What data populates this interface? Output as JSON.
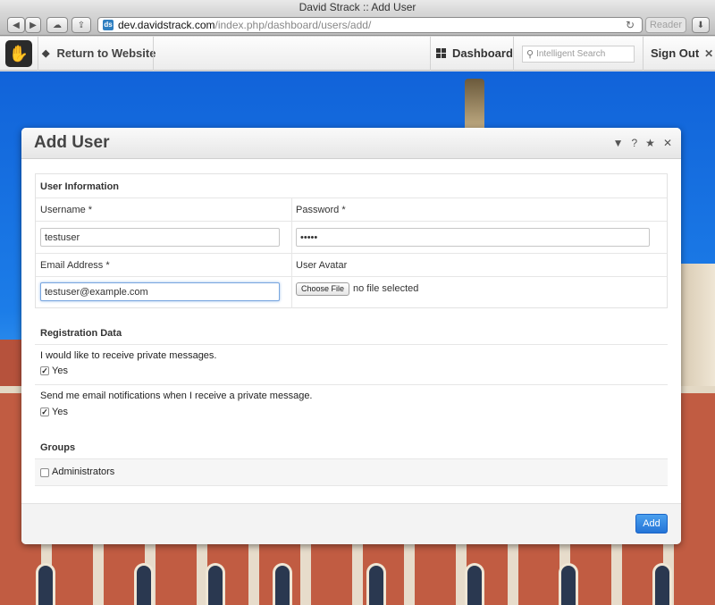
{
  "window": {
    "title": "David Strack :: Add User"
  },
  "browser": {
    "back_icon": "chevron-left-icon",
    "forward_icon": "chevron-right-icon",
    "address_host": "dev.davidstrack.com",
    "address_path": "/index.php/dashboard/users/add/",
    "reader_label": "Reader"
  },
  "cms_bar": {
    "return_label": "Return to Website",
    "dashboard_label": "Dashboard",
    "search_placeholder": "Intelligent Search",
    "signout_label": "Sign Out"
  },
  "dialog": {
    "title": "Add User",
    "controls": [
      "▼",
      "?",
      "★",
      "✕"
    ],
    "user_info": {
      "section_title": "User Information",
      "username_label": "Username *",
      "username_value": "testuser",
      "password_label": "Password *",
      "password_value": "•••••",
      "email_label": "Email Address *",
      "email_value": "testuser@example.com",
      "avatar_label": "User Avatar",
      "choose_file_label": "Choose File",
      "file_status": "no file selected"
    },
    "registration": {
      "section_title": "Registration Data",
      "q1": "I would like to receive private messages.",
      "q1_option": "Yes",
      "q1_checked": true,
      "q2": "Send me email notifications when I receive a private message.",
      "q2_option": "Yes",
      "q2_checked": true
    },
    "groups": {
      "section_title": "Groups",
      "item": "Administrators",
      "item_checked": false
    },
    "add_label": "Add"
  }
}
